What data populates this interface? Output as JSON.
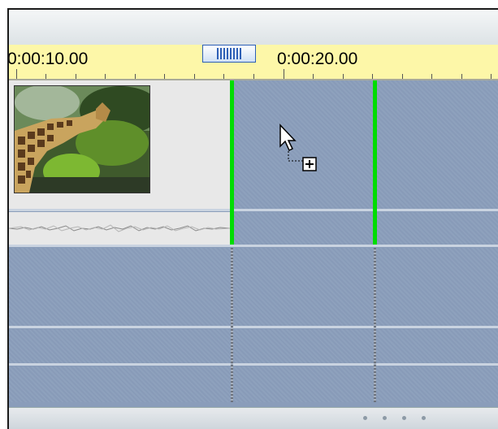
{
  "ruler": {
    "time_label_1": "0:00:10.00",
    "time_label_2": "0:00:20.00"
  },
  "timeline": {
    "video_clip_icon": "giraffe-video-thumbnail",
    "audio_clip_icon": "audio-waveform",
    "cursor_icon": "copy-drag-cursor"
  },
  "colors": {
    "ruler_bg": "#fdf7a8",
    "track_bg": "#8a9dba",
    "marker": "#00dd00"
  }
}
